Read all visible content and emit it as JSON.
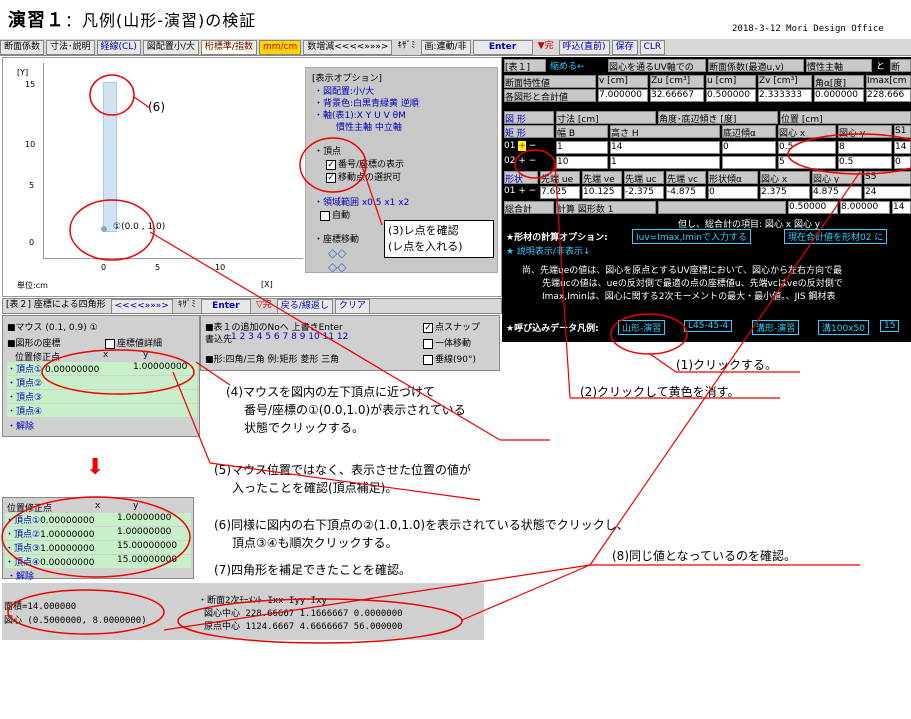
{
  "title": {
    "main": "演習１",
    "sub": "：凡例(山形-演習)の検証"
  },
  "date": "2018-3-12 Mori Design Office",
  "topbar": [
    "断面係数",
    "寸法･説明",
    "経線(CL)",
    "図配置小/大",
    "桁標準/指数",
    "mm/cm",
    "数増減<<<<»»»>",
    "ｷｻﾞﾐ",
    "画:連動/非",
    "Enter",
    "▼完",
    "呼込(直前)",
    "保存",
    "CLR"
  ],
  "plot": {
    "yaxis": "[Y]",
    "xaxis": "[X]",
    "unit": "単位:cm",
    "yticks": [
      "15",
      "10",
      "5",
      "0"
    ],
    "xticks": [
      "0",
      "5",
      "10"
    ],
    "vertex_label": "①(0.0 , 1.0)"
  },
  "options": {
    "title": "[表示オプション]",
    "layout": "・図配置:小/大",
    "bg": "・背景色:白黒青緑黄 逆順",
    "axis1": "・軸(表1):X Y U V θM",
    "axis2": "慣性主軸 中立軸",
    "vertex": "・頂点",
    "chk1": "番号/座標の表示",
    "chk2": "移動点の選択可",
    "range": "・領域範囲 x0.5 x1 x2",
    "auto": "自動",
    "move": "・座標移動"
  },
  "rbox": {
    "line1": "(3)レ点を確認",
    "line2": "(レ点を入れる)"
  },
  "bar2": [
    "[表２] 座標による四角形",
    "<<<<»»»>",
    "ｷｻﾞﾐ",
    "Enter",
    "▽完",
    "戻る/線返し",
    "クリア"
  ],
  "lpanel": {
    "mouse": "■マウス (0.1, 0.9)  ①",
    "coord": "■図形の座標",
    "detail": "座標値詳細",
    "hdr": [
      "位置修正点",
      "x",
      "y"
    ],
    "rows": [
      [
        "・頂点①",
        "0.00000000",
        "1.00000000"
      ],
      [
        "・頂点②",
        "",
        ""
      ],
      [
        "・頂点③",
        "",
        ""
      ],
      [
        "・頂点④",
        "",
        ""
      ]
    ],
    "release": "・解除"
  },
  "mid": {
    "add": "■表１の追加のNoへ 上書きEnter",
    "dest": "書込先",
    "nums": "1 2 3 4 5 6 7 8 9 10 11 12",
    "shape": "■形:四角/三角  例:矩形 菱形 三角",
    "snap": "点スナップ",
    "move": "一体移動",
    "perp": "垂線(90°)"
  },
  "right": {
    "hdr1": [
      "[表１]",
      "縮める←",
      "図心を通るUV軸での",
      "断面係数(最適u,v)",
      "慣性主軸",
      "と",
      "断"
    ],
    "r1h": [
      "断面特性値",
      "v [cm]",
      "Zu [cm³]",
      "u [cm]",
      "Zv [cm³]",
      "角α[度]",
      "Imax[cm"
    ],
    "r1v": [
      "各図形と合計値",
      "7.000000",
      "32.66667",
      "0.500000",
      "2.333333",
      "0.000000",
      "228.666"
    ],
    "shape_hdr": [
      "図 形",
      "寸法 [cm]",
      "角度･底辺傾き [度]",
      "位置 [cm]"
    ],
    "shape_cols": [
      "矩 形",
      "幅 B",
      "高さ H",
      "底辺傾α",
      "図心 x",
      "図心 y",
      "S1"
    ],
    "shape_rows": [
      [
        "01",
        "1",
        "14",
        "0",
        "0.5",
        "8",
        "14"
      ],
      [
        "02",
        "10",
        "1",
        "",
        "5",
        "0.5",
        "0"
      ]
    ],
    "sub_cols": [
      "形状",
      "先端 ue",
      "先端 ve",
      "先端 uc",
      "先端 vc",
      "形状傾α",
      "図心 x",
      "図心 y",
      "S5"
    ],
    "sub_row": [
      "01",
      "7.625",
      "10.125",
      "-2.375",
      "-4.875",
      "0",
      "2.375",
      "4.875",
      "24"
    ],
    "total": [
      "総合計",
      "計算 図形数 1",
      "",
      "0.50000",
      "8.00000",
      "14"
    ],
    "note1": "但し、総合計の項目:  図心 x     図心 y",
    "calc_opt": "★形材の計算オプション:",
    "calc_btn": "Iuv=Imax,Iminで入力する",
    "calc_btn2": "現在合計値を形材02 に",
    "desc_btn": "★ 説明表示/非表示↓",
    "desc1": "尚、先端ueの値は、図心を原点とするUV座標において、図心から左右方向で最",
    "desc2": "先端ucの値は、ueの反対側で最適の点の座標値u、先端vcはveの反対側で",
    "desc3": "Imax,Iminは、図心に関する2次モーメントの最大・最小値。、JIS 鋼材表",
    "call": "★呼び込みデータ凡例:",
    "legend": [
      "山形-演習",
      "L45-45-4",
      "溝形-演習",
      "溝100x50",
      "15"
    ]
  },
  "notes": {
    "n1": "(1)クリックする。",
    "n2": "(2)クリックして黄色を消す。",
    "n4a": "(4)マウスを図内の左下頂点に近づけて",
    "n4b": "番号/座標の①(0.0,1.0)が表示されている",
    "n4c": "状態でクリックする。",
    "n5a": "(5)マウス位置ではなく、表示させた位置の値が",
    "n5b": "入ったことを確認(頂点補足)。",
    "n6a": "(6)同様に図内の右下頂点の②(1.0,1.0)を表示されている状態でクリックし、",
    "n6b": "頂点③④も順次クリックする。",
    "n7": "(7)四角形を補足できたことを確認。",
    "n8": "(8)同じ値となっているのを確認。",
    "n6label": "(6)"
  },
  "p2": {
    "hdr": [
      "位置修正点",
      "x",
      "y"
    ],
    "rows": [
      [
        "・頂点①",
        "0.00000000",
        "1.00000000"
      ],
      [
        "・頂点②",
        "1.00000000",
        "1.00000000"
      ],
      [
        "・頂点③",
        "1.00000000",
        "15.00000000"
      ],
      [
        "・頂点④",
        "0.00000000",
        "15.00000000"
      ]
    ],
    "release": "・解除"
  },
  "p3": {
    "area": "面積=14.000000",
    "centroid": "図心 (0.5000000, 8.0000000)"
  },
  "p4": {
    "hdr": "・断面2次ﾓｰﾒﾝﾄ   Ixx        Iyy       Ixy",
    "r1": "図心中心   228.66667  1.1666667  0.0000000",
    "r2": "原点中心   1124.6667  4.6666667  56.000000"
  }
}
